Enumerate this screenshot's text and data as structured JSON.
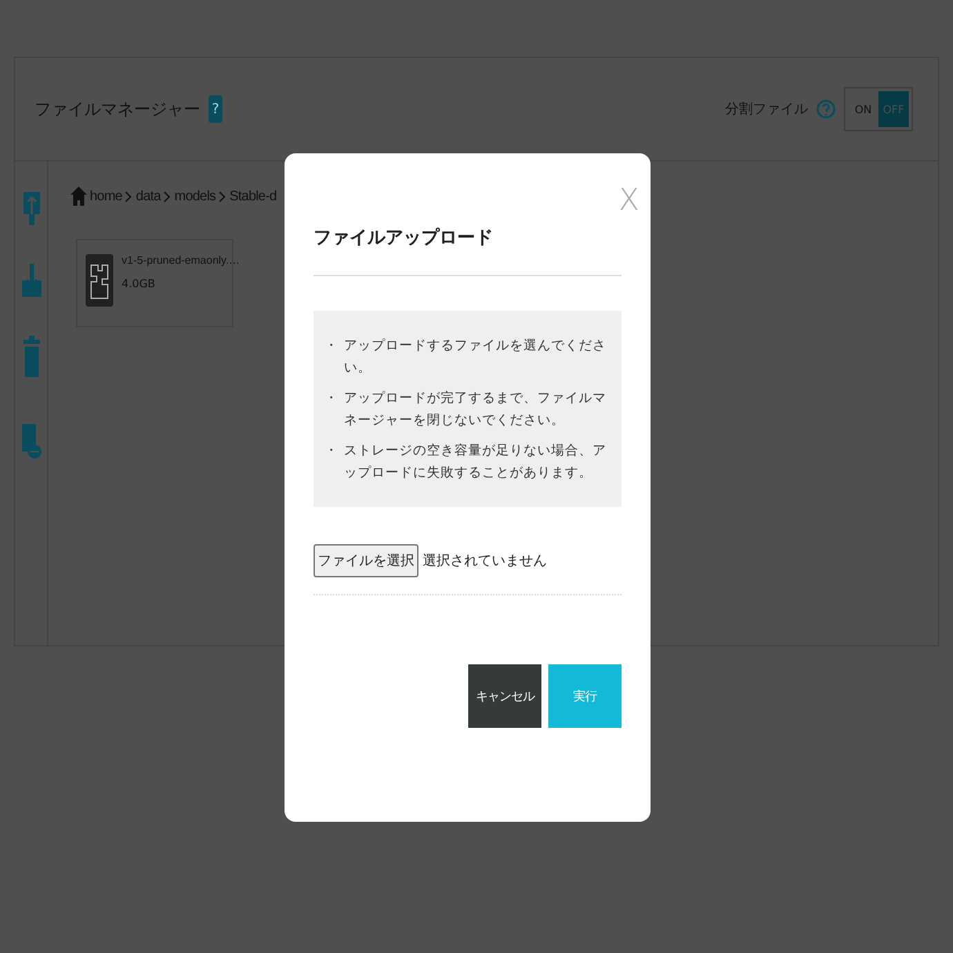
{
  "header": {
    "title": "ファイルマネージャー",
    "help": "?",
    "split_label": "分割ファイル",
    "toggle": [
      {
        "label": "ON",
        "selected": false
      },
      {
        "label": "OFF",
        "selected": true
      }
    ]
  },
  "breadcrumb": [
    "home",
    "data",
    "models",
    "Stable-d"
  ],
  "files": [
    {
      "name": "v1-5-pruned-emaonly.…",
      "size": "4.0GB"
    }
  ],
  "modal": {
    "title": "ファイルアップロード",
    "close": "X",
    "bullet": "・",
    "notes": [
      "アップロードするファイルを選んでください。",
      "アップロードが完了するまで、ファイルマネージャーを閉じないでください。",
      "ストレージの空き容量が足りない場合、アップロードに失敗することがあります。"
    ],
    "file_button": "ファイルを選択",
    "file_status": "選択されていません",
    "buttons": [
      {
        "label": "キャンセル",
        "kind": "cancel"
      },
      {
        "label": "実行",
        "kind": "primary"
      }
    ]
  }
}
